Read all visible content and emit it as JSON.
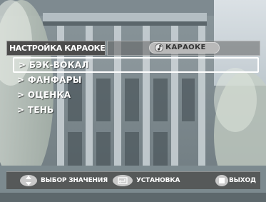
{
  "header": {
    "title": "НАСТРОЙКА КАРАОКЕ",
    "mode_label": "КАРАОКЕ",
    "mode_icon": "music-note-icon"
  },
  "menu": {
    "items": [
      {
        "label": "> БЭК-ВОКАЛ",
        "selected": true
      },
      {
        "label": "> ФАНФАРЫ",
        "selected": false
      },
      {
        "label": "> ОЦЕНКА",
        "selected": false
      },
      {
        "label": "> ТЕНЬ",
        "selected": false
      }
    ]
  },
  "footer": {
    "select_label": "ВЫБОР ЗНАЧЕНИЯ",
    "select_icon": "up-down-arrows-icon",
    "enter_label": "УСТАНОВКА",
    "enter_icon": "enter-icon",
    "exit_label": "ВЫХОД",
    "exit_icon": "stop-icon"
  },
  "colors": {
    "header_bg": "#4c4c4c",
    "pill_bg": "#b9b9b9",
    "footer_bg": "#505050",
    "text": "#ffffff"
  }
}
